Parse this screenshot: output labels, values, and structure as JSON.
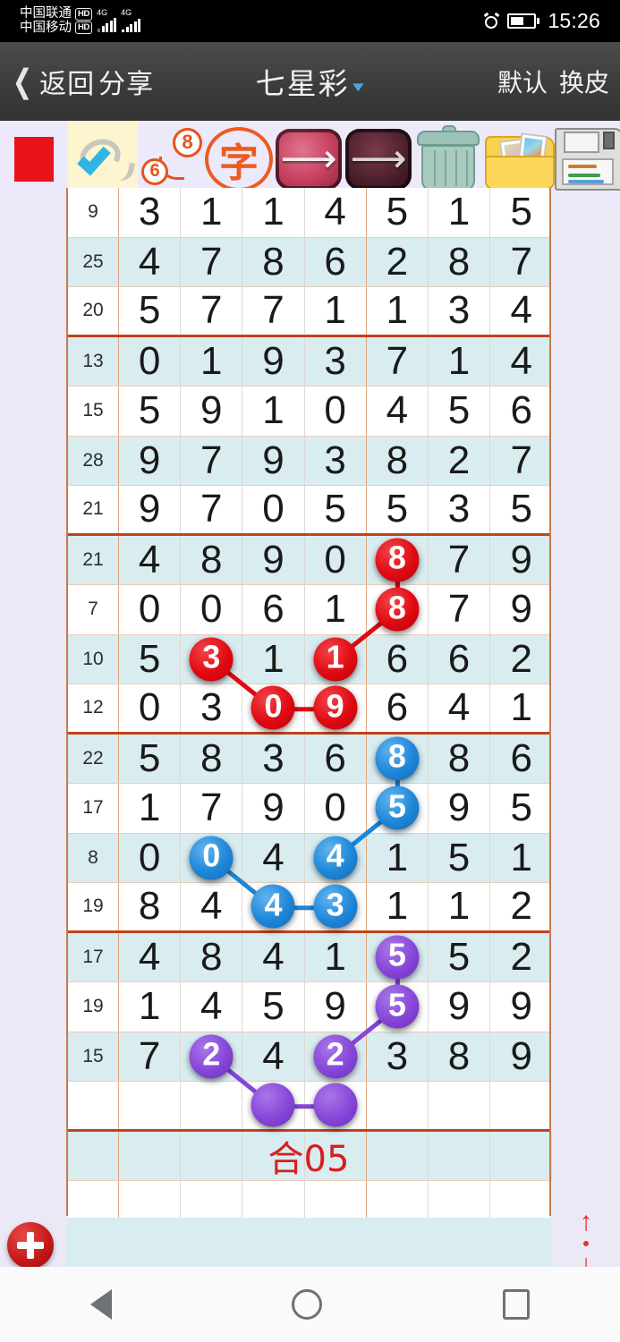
{
  "status_bar": {
    "carrier1": "中国联通",
    "carrier2": "中国移动",
    "hd_badge": "HD",
    "net1": "4G",
    "net2": "4G",
    "alarm_icon": "alarm-clock-icon",
    "battery_icon": "battery-icon",
    "time": "15:26"
  },
  "title_bar": {
    "back_label": "返回",
    "share_label": "分享",
    "title": "七星彩",
    "caret_icon": "chevron-down-icon",
    "right_1": "默认",
    "right_2": "换皮"
  },
  "toolbar": {
    "items": [
      {
        "name": "color-swatch-red",
        "icon": "red-square-icon",
        "selected": false
      },
      {
        "name": "check-pen",
        "icon": "check-pen-icon",
        "selected": true
      },
      {
        "name": "number-link",
        "icon": "six-eight-bubble-icon",
        "selected": false,
        "label_a": "6",
        "label_b": "8"
      },
      {
        "name": "text-stamp",
        "icon": "zi-stamp-icon",
        "selected": false,
        "label": "字"
      },
      {
        "name": "prev",
        "icon": "arrow-left-icon",
        "selected": false
      },
      {
        "name": "next",
        "icon": "arrow-right-icon",
        "selected": false
      },
      {
        "name": "delete",
        "icon": "trash-can-icon",
        "selected": false
      },
      {
        "name": "gallery",
        "icon": "photo-folder-icon",
        "selected": false
      },
      {
        "name": "save",
        "icon": "floppy-disk-icon",
        "selected": false
      }
    ]
  },
  "grid": {
    "columns": 8,
    "rows": [
      {
        "index": "9",
        "digits": [
          "3",
          "1",
          "1",
          "4",
          "5",
          "1",
          "5"
        ],
        "shade": "even",
        "block": 0
      },
      {
        "index": "25",
        "digits": [
          "4",
          "7",
          "8",
          "6",
          "2",
          "8",
          "7"
        ],
        "shade": "odd",
        "block": 0
      },
      {
        "index": "20",
        "digits": [
          "5",
          "7",
          "7",
          "1",
          "1",
          "3",
          "4"
        ],
        "shade": "even",
        "block": 0,
        "block_end": true
      },
      {
        "index": "13",
        "digits": [
          "0",
          "1",
          "9",
          "3",
          "7",
          "1",
          "4"
        ],
        "shade": "odd",
        "block": 1
      },
      {
        "index": "15",
        "digits": [
          "5",
          "9",
          "1",
          "0",
          "4",
          "5",
          "6"
        ],
        "shade": "even",
        "block": 1
      },
      {
        "index": "28",
        "digits": [
          "9",
          "7",
          "9",
          "3",
          "8",
          "2",
          "7"
        ],
        "shade": "odd",
        "block": 1
      },
      {
        "index": "21",
        "digits": [
          "9",
          "7",
          "0",
          "5",
          "5",
          "3",
          "5"
        ],
        "shade": "even",
        "block": 1,
        "block_end": true
      },
      {
        "index": "21",
        "digits": [
          "4",
          "8",
          "9",
          "0",
          "8",
          "7",
          "9"
        ],
        "shade": "odd",
        "block": 2,
        "marks": [
          {
            "col": 5,
            "color": "red"
          }
        ]
      },
      {
        "index": "7",
        "digits": [
          "0",
          "0",
          "6",
          "1",
          "8",
          "7",
          "9"
        ],
        "shade": "even",
        "block": 2,
        "marks": [
          {
            "col": 5,
            "color": "red"
          }
        ]
      },
      {
        "index": "10",
        "digits": [
          "5",
          "3",
          "1",
          "1",
          "6",
          "6",
          "2"
        ],
        "shade": "odd",
        "block": 2,
        "marks": [
          {
            "col": 2,
            "color": "red"
          },
          {
            "col": 4,
            "color": "red"
          }
        ]
      },
      {
        "index": "12",
        "digits": [
          "0",
          "3",
          "0",
          "9",
          "6",
          "4",
          "1"
        ],
        "shade": "even",
        "block": 2,
        "block_end": true,
        "marks": [
          {
            "col": 3,
            "color": "red"
          },
          {
            "col": 4,
            "color": "red"
          }
        ]
      },
      {
        "index": "22",
        "digits": [
          "5",
          "8",
          "3",
          "6",
          "8",
          "8",
          "6"
        ],
        "shade": "odd",
        "block": 3,
        "marks": [
          {
            "col": 5,
            "color": "blue"
          }
        ]
      },
      {
        "index": "17",
        "digits": [
          "1",
          "7",
          "9",
          "0",
          "5",
          "9",
          "5"
        ],
        "shade": "even",
        "block": 3,
        "marks": [
          {
            "col": 5,
            "color": "blue"
          }
        ]
      },
      {
        "index": "8",
        "digits": [
          "0",
          "0",
          "4",
          "4",
          "1",
          "5",
          "1"
        ],
        "shade": "odd",
        "block": 3,
        "marks": [
          {
            "col": 2,
            "color": "blue"
          },
          {
            "col": 4,
            "color": "blue"
          }
        ]
      },
      {
        "index": "19",
        "digits": [
          "8",
          "4",
          "4",
          "3",
          "1",
          "1",
          "2"
        ],
        "shade": "even",
        "block": 3,
        "block_end": true,
        "marks": [
          {
            "col": 3,
            "color": "blue"
          },
          {
            "col": 4,
            "color": "blue"
          }
        ]
      },
      {
        "index": "17",
        "digits": [
          "4",
          "8",
          "4",
          "1",
          "5",
          "5",
          "2"
        ],
        "shade": "odd",
        "block": 4,
        "marks": [
          {
            "col": 5,
            "color": "purple"
          }
        ]
      },
      {
        "index": "19",
        "digits": [
          "1",
          "4",
          "5",
          "9",
          "5",
          "9",
          "9"
        ],
        "shade": "even",
        "block": 4,
        "marks": [
          {
            "col": 5,
            "color": "purple"
          }
        ]
      },
      {
        "index": "15",
        "digits": [
          "7",
          "2",
          "4",
          "2",
          "3",
          "8",
          "9"
        ],
        "shade": "odd",
        "block": 4,
        "marks": [
          {
            "col": 2,
            "color": "purple"
          },
          {
            "col": 4,
            "color": "purple"
          }
        ]
      },
      {
        "index": "",
        "digits": [
          "",
          "",
          "",
          "",
          "",
          "",
          ""
        ],
        "shade": "even",
        "block": 4,
        "block_end": true,
        "marks": [
          {
            "col": 3,
            "color": "purple",
            "blank": true
          },
          {
            "col": 4,
            "color": "purple",
            "blank": true
          }
        ]
      },
      {
        "index": "",
        "digits": [
          "",
          "",
          "",
          "",
          "",
          "",
          ""
        ],
        "shade": "odd",
        "block": 5,
        "sum_label": "合05"
      },
      {
        "index": "",
        "digits": [
          "",
          "",
          "",
          "",
          "",
          "",
          ""
        ],
        "shade": "even",
        "block": 5
      }
    ],
    "connections": [
      {
        "color": "red",
        "from": {
          "row": 7,
          "col": 5
        },
        "to": {
          "row": 8,
          "col": 5
        }
      },
      {
        "color": "red",
        "from": {
          "row": 8,
          "col": 5
        },
        "to": {
          "row": 9,
          "col": 4
        }
      },
      {
        "color": "red",
        "from": {
          "row": 9,
          "col": 2
        },
        "to": {
          "row": 10,
          "col": 3
        }
      },
      {
        "color": "red",
        "from": {
          "row": 10,
          "col": 3
        },
        "to": {
          "row": 10,
          "col": 4
        }
      },
      {
        "color": "blue",
        "from": {
          "row": 11,
          "col": 5
        },
        "to": {
          "row": 12,
          "col": 5
        }
      },
      {
        "color": "blue",
        "from": {
          "row": 12,
          "col": 5
        },
        "to": {
          "row": 13,
          "col": 4
        }
      },
      {
        "color": "blue",
        "from": {
          "row": 13,
          "col": 2
        },
        "to": {
          "row": 14,
          "col": 3
        }
      },
      {
        "color": "blue",
        "from": {
          "row": 14,
          "col": 3
        },
        "to": {
          "row": 14,
          "col": 4
        }
      },
      {
        "color": "purple",
        "from": {
          "row": 15,
          "col": 5
        },
        "to": {
          "row": 16,
          "col": 5
        }
      },
      {
        "color": "purple",
        "from": {
          "row": 16,
          "col": 5
        },
        "to": {
          "row": 17,
          "col": 4
        }
      },
      {
        "color": "purple",
        "from": {
          "row": 17,
          "col": 2
        },
        "to": {
          "row": 18,
          "col": 3
        }
      },
      {
        "color": "purple",
        "from": {
          "row": 18,
          "col": 3
        },
        "to": {
          "row": 18,
          "col": 4
        }
      }
    ],
    "sum_label": "合05"
  },
  "footer": {
    "add_button_icon": "plus-circle-icon",
    "scroll_icon": "up-down-arrows-icon"
  },
  "nav_bar": {
    "back_icon": "triangle-back-icon",
    "home_icon": "circle-home-icon",
    "recents_icon": "square-recents-icon"
  },
  "colors": {
    "accent_red": "#e00a12",
    "accent_blue": "#1e86d8",
    "accent_purple": "#8646d8",
    "block_divider": "#c0431b",
    "row_shade": "#d9ecf0",
    "page_bg": "#eceafa"
  }
}
